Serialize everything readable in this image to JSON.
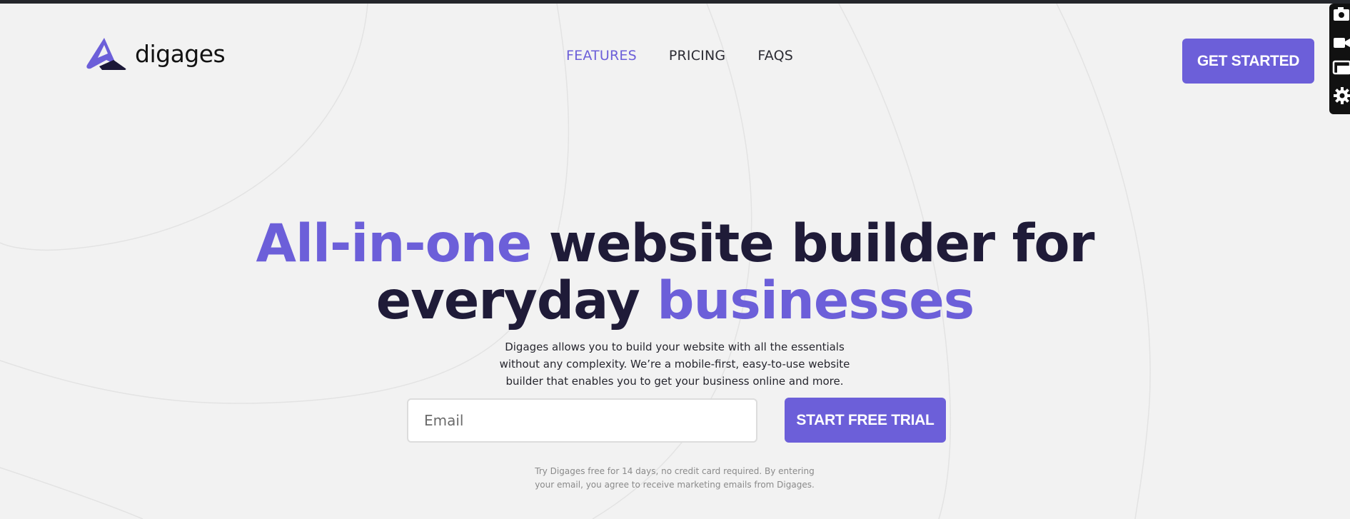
{
  "brand": {
    "name": "digages",
    "accent": "#6c5fd9",
    "dark": "#1f1b38"
  },
  "nav": {
    "items": [
      {
        "label": "FEATURES",
        "active": true
      },
      {
        "label": "PRICING",
        "active": false
      },
      {
        "label": "FAQS",
        "active": false
      }
    ],
    "cta_label": "GET STARTED"
  },
  "hero": {
    "title_part1": "All-in-one",
    "title_part2": " website builder for",
    "title_part3": "everyday ",
    "title_part4": "businesses",
    "subtitle": "Digages allows you to build your website with all the essentials without any complexity. We’re a mobile-first, easy-to-use website builder that enables you to get your business online and more.",
    "email_placeholder": "Email",
    "trial_label": "START FREE TRIAL",
    "disclaimer": "Try Digages free for 14 days, no credit card required. By entering your email, you agree to receive marketing emails from Digages."
  },
  "side_tools": {
    "icons": [
      "camera-icon",
      "video-icon",
      "screen-icon",
      "gear-icon"
    ]
  }
}
